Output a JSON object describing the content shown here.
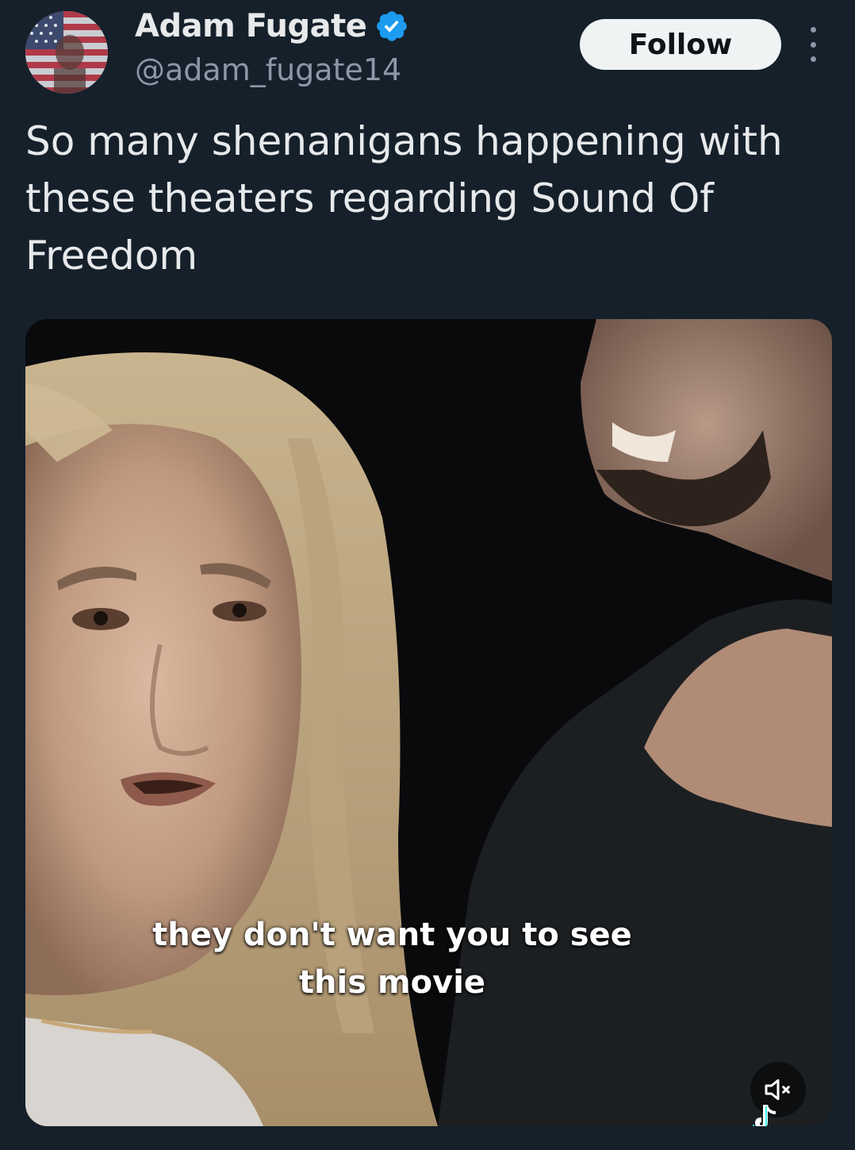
{
  "tweet": {
    "author": {
      "display_name": "Adam Fugate",
      "handle": "@adam_fugate14",
      "verified": true,
      "avatar_icon": "american-flag-avatar"
    },
    "follow_label": "Follow",
    "more_icon": "more-vertical-icon",
    "text": "So many shenanigans happening with these theaters regarding Sound Of Freedom",
    "media": {
      "type": "video",
      "caption_line1": "they don't want you to see",
      "caption_line2": "this movie",
      "mute_icon": "speaker-muted-icon",
      "watermark_icon": "tiktok-icon"
    }
  },
  "colors": {
    "background": "#15202b",
    "text_primary": "#e7e9ea",
    "text_secondary": "#8b98a5",
    "verified_blue": "#1d9bf0",
    "follow_bg": "#eff3f4"
  }
}
